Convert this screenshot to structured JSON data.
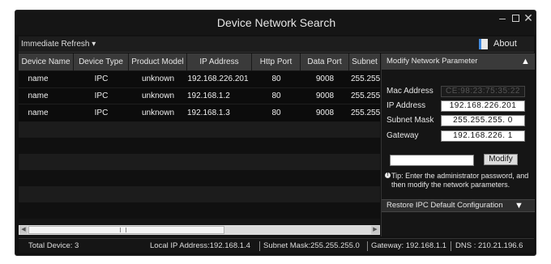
{
  "window": {
    "title": "Device Network Search",
    "controls": [
      "minimize",
      "maximize",
      "close"
    ]
  },
  "toolbar": {
    "refresh_label": "Immediate Refresh",
    "about_label": "About"
  },
  "table": {
    "columns": [
      "Device Name",
      "Device Type",
      "Product Model",
      "IP Address",
      "Http Port",
      "Data Port",
      "Subnet"
    ],
    "rows": [
      {
        "name": "name",
        "type": "IPC",
        "model": "unknown",
        "ip": "192.168.226.201",
        "http_port": "80",
        "data_port": "9008",
        "subnet": "255.255"
      },
      {
        "name": "name",
        "type": "IPC",
        "model": "unknown",
        "ip": "192.168.1.2",
        "http_port": "80",
        "data_port": "9008",
        "subnet": "255.255"
      },
      {
        "name": "name",
        "type": "IPC",
        "model": "unknown",
        "ip": "192.168.1.3",
        "http_port": "80",
        "data_port": "9008",
        "subnet": "255.255"
      }
    ]
  },
  "modify_panel": {
    "header": "Modify Network Parameter",
    "mac_label": "Mac Address",
    "mac_value": "CE:98:23:75:35:22",
    "ip_label": "IP Address",
    "ip_value": "192.168.226.201",
    "mask_label": "Subnet Mask",
    "mask_value": "255.255.255. 0",
    "gateway_label": "Gateway",
    "gateway_value": "192.168.226. 1",
    "modify_button": "Modify",
    "tip": "Tip: Enter the administrator password, and then modify the network parameters.",
    "restore_header": "Restore IPC Default Configuration"
  },
  "status": {
    "total": "Total Device: 3",
    "local_ip": "Local IP Address:192.168.1.4",
    "mask": "Subnet Mask:255.255.255.0",
    "gateway": "Gateway: 192.168.1.1",
    "dns": "DNS : 210.21.196.6"
  },
  "colors": {
    "window_bg": "#111111",
    "header_bg": "#3a3a3a",
    "text": "#e6e6e6",
    "about_icon_accent": "#3f8ae0"
  }
}
